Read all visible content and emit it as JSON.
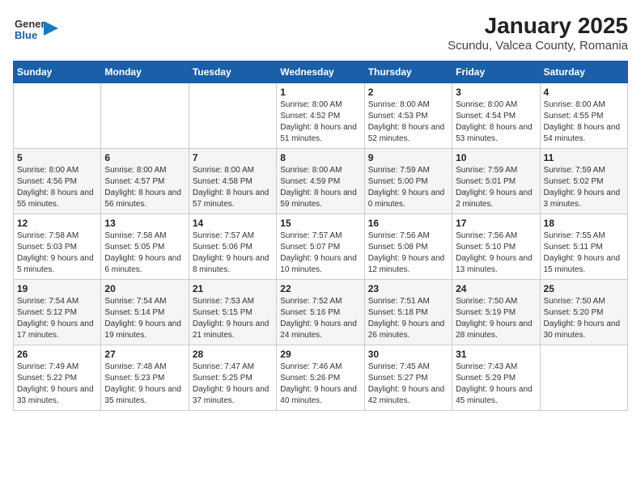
{
  "header": {
    "logo_general": "General",
    "logo_blue": "Blue",
    "title": "January 2025",
    "subtitle": "Scundu, Valcea County, Romania"
  },
  "weekdays": [
    "Sunday",
    "Monday",
    "Tuesday",
    "Wednesday",
    "Thursday",
    "Friday",
    "Saturday"
  ],
  "weeks": [
    [
      {
        "day": "",
        "info": ""
      },
      {
        "day": "",
        "info": ""
      },
      {
        "day": "",
        "info": ""
      },
      {
        "day": "1",
        "info": "Sunrise: 8:00 AM\nSunset: 4:52 PM\nDaylight: 8 hours and 51 minutes."
      },
      {
        "day": "2",
        "info": "Sunrise: 8:00 AM\nSunset: 4:53 PM\nDaylight: 8 hours and 52 minutes."
      },
      {
        "day": "3",
        "info": "Sunrise: 8:00 AM\nSunset: 4:54 PM\nDaylight: 8 hours and 53 minutes."
      },
      {
        "day": "4",
        "info": "Sunrise: 8:00 AM\nSunset: 4:55 PM\nDaylight: 8 hours and 54 minutes."
      }
    ],
    [
      {
        "day": "5",
        "info": "Sunrise: 8:00 AM\nSunset: 4:56 PM\nDaylight: 8 hours and 55 minutes."
      },
      {
        "day": "6",
        "info": "Sunrise: 8:00 AM\nSunset: 4:57 PM\nDaylight: 8 hours and 56 minutes."
      },
      {
        "day": "7",
        "info": "Sunrise: 8:00 AM\nSunset: 4:58 PM\nDaylight: 8 hours and 57 minutes."
      },
      {
        "day": "8",
        "info": "Sunrise: 8:00 AM\nSunset: 4:59 PM\nDaylight: 8 hours and 59 minutes."
      },
      {
        "day": "9",
        "info": "Sunrise: 7:59 AM\nSunset: 5:00 PM\nDaylight: 9 hours and 0 minutes."
      },
      {
        "day": "10",
        "info": "Sunrise: 7:59 AM\nSunset: 5:01 PM\nDaylight: 9 hours and 2 minutes."
      },
      {
        "day": "11",
        "info": "Sunrise: 7:59 AM\nSunset: 5:02 PM\nDaylight: 9 hours and 3 minutes."
      }
    ],
    [
      {
        "day": "12",
        "info": "Sunrise: 7:58 AM\nSunset: 5:03 PM\nDaylight: 9 hours and 5 minutes."
      },
      {
        "day": "13",
        "info": "Sunrise: 7:58 AM\nSunset: 5:05 PM\nDaylight: 9 hours and 6 minutes."
      },
      {
        "day": "14",
        "info": "Sunrise: 7:57 AM\nSunset: 5:06 PM\nDaylight: 9 hours and 8 minutes."
      },
      {
        "day": "15",
        "info": "Sunrise: 7:57 AM\nSunset: 5:07 PM\nDaylight: 9 hours and 10 minutes."
      },
      {
        "day": "16",
        "info": "Sunrise: 7:56 AM\nSunset: 5:08 PM\nDaylight: 9 hours and 12 minutes."
      },
      {
        "day": "17",
        "info": "Sunrise: 7:56 AM\nSunset: 5:10 PM\nDaylight: 9 hours and 13 minutes."
      },
      {
        "day": "18",
        "info": "Sunrise: 7:55 AM\nSunset: 5:11 PM\nDaylight: 9 hours and 15 minutes."
      }
    ],
    [
      {
        "day": "19",
        "info": "Sunrise: 7:54 AM\nSunset: 5:12 PM\nDaylight: 9 hours and 17 minutes."
      },
      {
        "day": "20",
        "info": "Sunrise: 7:54 AM\nSunset: 5:14 PM\nDaylight: 9 hours and 19 minutes."
      },
      {
        "day": "21",
        "info": "Sunrise: 7:53 AM\nSunset: 5:15 PM\nDaylight: 9 hours and 21 minutes."
      },
      {
        "day": "22",
        "info": "Sunrise: 7:52 AM\nSunset: 5:16 PM\nDaylight: 9 hours and 24 minutes."
      },
      {
        "day": "23",
        "info": "Sunrise: 7:51 AM\nSunset: 5:18 PM\nDaylight: 9 hours and 26 minutes."
      },
      {
        "day": "24",
        "info": "Sunrise: 7:50 AM\nSunset: 5:19 PM\nDaylight: 9 hours and 28 minutes."
      },
      {
        "day": "25",
        "info": "Sunrise: 7:50 AM\nSunset: 5:20 PM\nDaylight: 9 hours and 30 minutes."
      }
    ],
    [
      {
        "day": "26",
        "info": "Sunrise: 7:49 AM\nSunset: 5:22 PM\nDaylight: 9 hours and 33 minutes."
      },
      {
        "day": "27",
        "info": "Sunrise: 7:48 AM\nSunset: 5:23 PM\nDaylight: 9 hours and 35 minutes."
      },
      {
        "day": "28",
        "info": "Sunrise: 7:47 AM\nSunset: 5:25 PM\nDaylight: 9 hours and 37 minutes."
      },
      {
        "day": "29",
        "info": "Sunrise: 7:46 AM\nSunset: 5:26 PM\nDaylight: 9 hours and 40 minutes."
      },
      {
        "day": "30",
        "info": "Sunrise: 7:45 AM\nSunset: 5:27 PM\nDaylight: 9 hours and 42 minutes."
      },
      {
        "day": "31",
        "info": "Sunrise: 7:43 AM\nSunset: 5:29 PM\nDaylight: 9 hours and 45 minutes."
      },
      {
        "day": "",
        "info": ""
      }
    ]
  ]
}
